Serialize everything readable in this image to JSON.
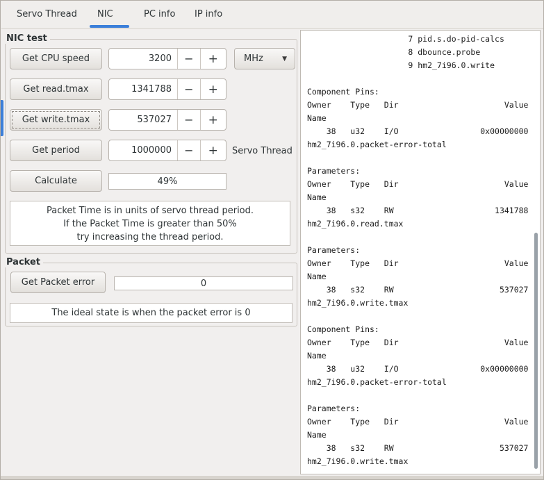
{
  "colors": {
    "accent": "#3c7fd9",
    "scrollbar_thumb": "#99a1a8",
    "window_bg": "#f1efee"
  },
  "tabs": [
    {
      "label": "Servo Thread",
      "active": false
    },
    {
      "label": "NIC",
      "active": true
    },
    {
      "label": "PC info",
      "active": false
    },
    {
      "label": "IP info",
      "active": false
    }
  ],
  "icons": {
    "minus": "−",
    "plus": "+",
    "dropdown_arrow": "▼"
  },
  "nic_test": {
    "title": "NIC test",
    "rows": [
      {
        "button": "Get CPU speed",
        "value": "3200",
        "unit": "MHz"
      },
      {
        "button": "Get read.tmax",
        "value": "1341788"
      },
      {
        "button": "Get write.tmax",
        "value": "537027"
      },
      {
        "button": "Get period",
        "value": "1000000",
        "side_label": "Servo Thread"
      }
    ],
    "calculate_button": "Calculate",
    "packet_time_percent": "49%",
    "note_line1": "Packet Time is in units of servo thread period.",
    "note_line2": "If the Packet Time is greater than 50%",
    "note_line3": "try increasing the thread period."
  },
  "packet": {
    "title": "Packet",
    "button": "Get Packet error",
    "value": "0",
    "note": "The ideal state is when the packet error is 0"
  },
  "output": {
    "lines": [
      "                     7 pid.s.do-pid-calcs",
      "                     8 dbounce.probe",
      "                     9 hm2_7i96.0.write",
      "",
      "Component Pins:",
      "Owner    Type   Dir                      Value",
      "Name",
      "    38   u32    I/O                 0x00000000",
      "hm2_7i96.0.packet-error-total",
      "",
      "Parameters:",
      "Owner    Type   Dir                      Value",
      "Name",
      "    38   s32    RW                     1341788",
      "hm2_7i96.0.read.tmax",
      "",
      "Parameters:",
      "Owner    Type   Dir                      Value",
      "Name",
      "    38   s32    RW                      537027",
      "hm2_7i96.0.write.tmax",
      "",
      "Component Pins:",
      "Owner    Type   Dir                      Value",
      "Name",
      "    38   u32    I/O                 0x00000000",
      "hm2_7i96.0.packet-error-total",
      "",
      "Parameters:",
      "Owner    Type   Dir                      Value",
      "Name",
      "    38   s32    RW                      537027",
      "hm2_7i96.0.write.tmax"
    ]
  }
}
